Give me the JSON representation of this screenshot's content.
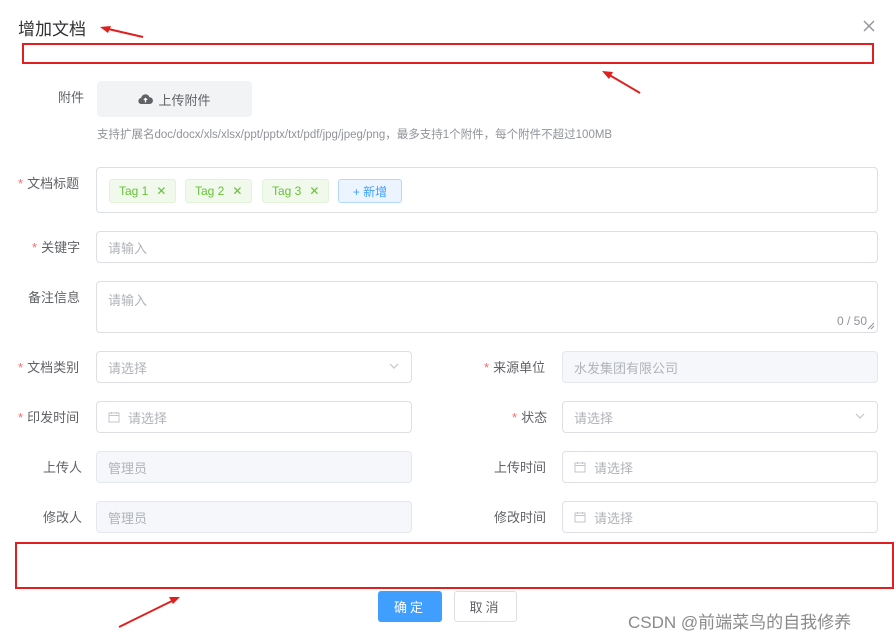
{
  "dialog": {
    "title": "增加文档"
  },
  "form": {
    "attachment": {
      "label": "附件",
      "button_label": "上传附件",
      "tip": "支持扩展名doc/docx/xls/xlsx/ppt/pptx/txt/pdf/jpg/jpeg/png，最多支持1个附件，每个附件不超过100MB"
    },
    "doc_title": {
      "label": "文档标题",
      "required": true,
      "tags": [
        "Tag 1",
        "Tag 2",
        "Tag 3"
      ],
      "add_label": "+ 新增"
    },
    "keyword": {
      "label": "关键字",
      "required": true,
      "placeholder": "请输入"
    },
    "remarks": {
      "label": "备注信息",
      "placeholder": "请输入",
      "counter": "0 / 50"
    },
    "doc_type": {
      "label": "文档类别",
      "required": true,
      "placeholder": "请选择"
    },
    "source_unit": {
      "label": "来源单位",
      "required": true,
      "value": "水发集团有限公司"
    },
    "issue_time": {
      "label": "印发时间",
      "required": true,
      "placeholder": "请选择"
    },
    "status": {
      "label": "状态",
      "required": true,
      "placeholder": "请选择"
    },
    "uploader": {
      "label": "上传人",
      "value": "管理员"
    },
    "upload_time": {
      "label": "上传时间",
      "placeholder": "请选择"
    },
    "modifier": {
      "label": "修改人",
      "value": "管理员"
    },
    "modify_time": {
      "label": "修改时间",
      "placeholder": "请选择"
    }
  },
  "footer": {
    "ok_label": "确定",
    "cancel_label": "取消"
  },
  "watermark": "CSDN @前端菜鸟的自我修养",
  "colors": {
    "primary": "#409eff",
    "required": "#f56c6c",
    "annotation": "#e02020",
    "tag_text": "#67c23a"
  },
  "icons": [
    "close-icon",
    "cloud-upload-icon",
    "calendar-icon",
    "chevron-down-icon",
    "tag-close-icon",
    "resize-handle-icon"
  ]
}
